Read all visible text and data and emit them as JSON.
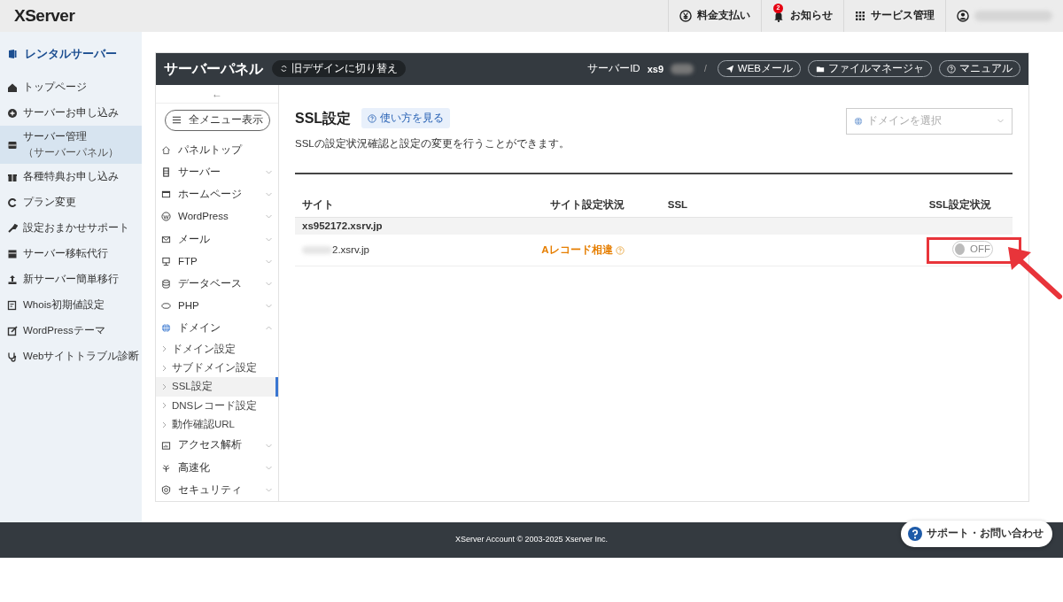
{
  "top_bar": {
    "logo": "XServer",
    "items": [
      {
        "label": "料金支払い"
      },
      {
        "label": "お知らせ",
        "badge": "2"
      },
      {
        "label": "サービス管理"
      }
    ]
  },
  "sidebar": {
    "title": "レンタルサーバー",
    "items": [
      {
        "label": "トップページ",
        "selected": false
      },
      {
        "label": "サーバーお申し込み",
        "selected": false
      },
      {
        "label": "サーバー管理",
        "sublabel": "（サーバーパネル）",
        "selected": true
      },
      {
        "label": "各種特典お申し込み",
        "selected": false
      },
      {
        "label": "プラン変更",
        "selected": false
      },
      {
        "label": "設定おまかせサポート",
        "selected": false
      },
      {
        "label": "サーバー移転代行",
        "selected": false
      },
      {
        "label": "新サーバー簡単移行",
        "selected": false
      },
      {
        "label": "Whois初期値設定",
        "selected": false
      },
      {
        "label": "WordPressテーマ",
        "selected": false
      },
      {
        "label": "Webサイトトラブル診断",
        "selected": false
      }
    ]
  },
  "panel": {
    "title": "サーバーパネル",
    "switch_button": "旧デザインに切り替え",
    "server_id_label": "サーバーID",
    "server_id_value": "xs9",
    "separator": "/",
    "buttons": [
      "WEBメール",
      "ファイルマネージャ",
      "マニュアル"
    ]
  },
  "panel_menu": {
    "back": "←",
    "all_menu_button": "全メニュー表示",
    "items": [
      {
        "label": "パネルトップ"
      },
      {
        "label": "サーバー",
        "expanded": false
      },
      {
        "label": "ホームページ",
        "expanded": false
      },
      {
        "label": "WordPress",
        "expanded": false
      },
      {
        "label": "メール",
        "expanded": false
      },
      {
        "label": "FTP",
        "expanded": false
      },
      {
        "label": "データベース",
        "expanded": false
      },
      {
        "label": "PHP",
        "expanded": false
      },
      {
        "label": "ドメイン",
        "expanded": true,
        "children": [
          {
            "label": "ドメイン設定",
            "selected": false
          },
          {
            "label": "サブドメイン設定",
            "selected": false
          },
          {
            "label": "SSL設定",
            "selected": true
          },
          {
            "label": "DNSレコード設定",
            "selected": false
          },
          {
            "label": "動作確認URL",
            "selected": false
          }
        ]
      },
      {
        "label": "アクセス解析",
        "expanded": false
      },
      {
        "label": "高速化",
        "expanded": false
      },
      {
        "label": "セキュリティ",
        "expanded": false
      }
    ]
  },
  "content": {
    "title": "SSL設定",
    "help_button": "使い方を見る",
    "description": "SSLの設定状況確認と設定の変更を行うことができます。",
    "domain_select": {
      "placeholder": "ドメインを選択"
    },
    "table": {
      "columns": [
        "サイト",
        "サイト設定状況",
        "SSL",
        "SSL設定状況"
      ],
      "groups": [
        {
          "name": "xs952172.xsrv.jp",
          "rows": [
            {
              "site": "2.xsrv.jp",
              "status": "Aレコード相違",
              "toggle": {
                "on": false,
                "label": "OFF"
              }
            }
          ]
        }
      ]
    }
  },
  "footer": {
    "copyright": "XServer Account © 2003-2025 Xserver Inc.",
    "support_button": "サポート・お問い合わせ"
  }
}
